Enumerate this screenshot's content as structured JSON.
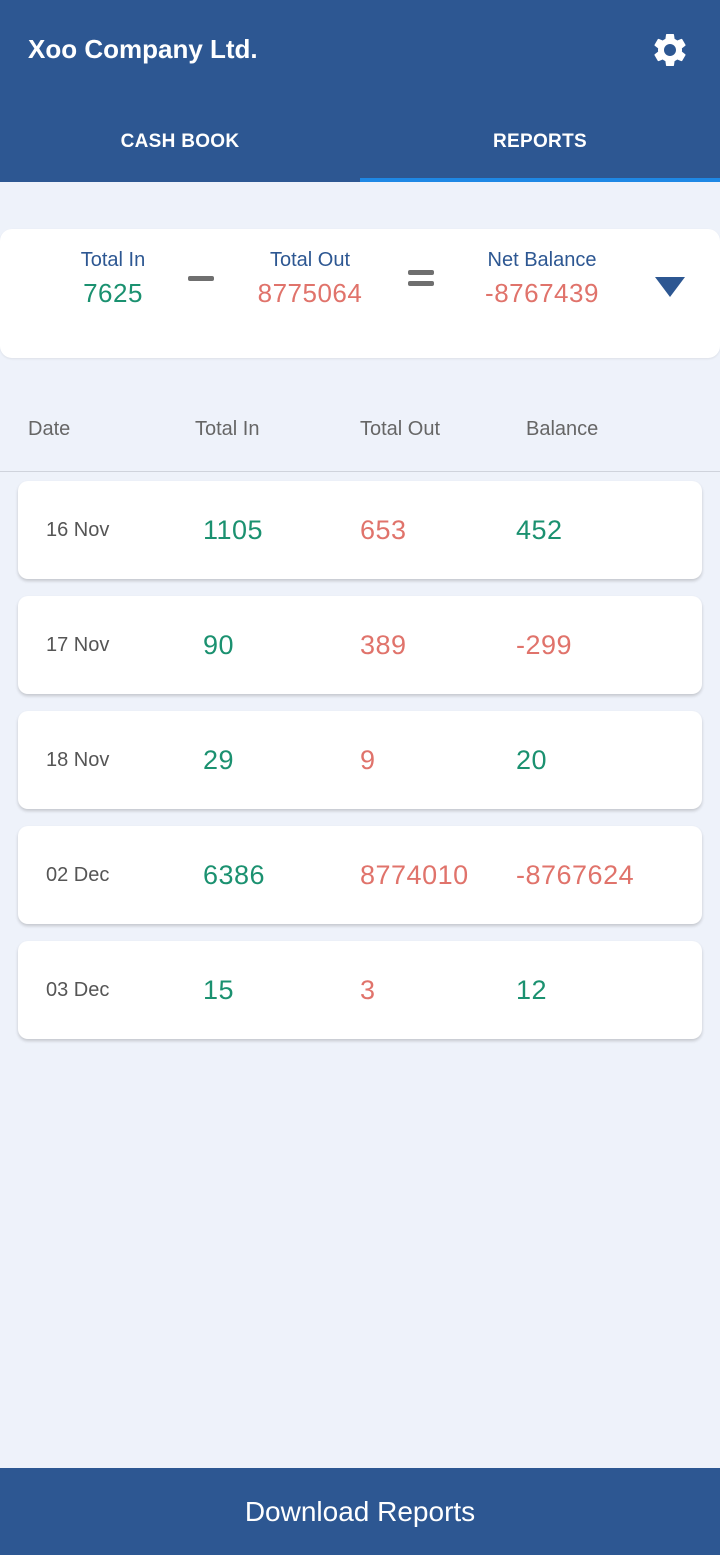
{
  "app": {
    "title": "Xoo Company Ltd."
  },
  "tabs": [
    {
      "label": "CASH BOOK",
      "active": false
    },
    {
      "label": "REPORTS",
      "active": true
    }
  ],
  "summary": {
    "total_in_label": "Total In",
    "total_in_value": "7625",
    "total_out_label": "Total Out",
    "total_out_value": "8775064",
    "net_label": "Net Balance",
    "net_value": "-8767439"
  },
  "table": {
    "headers": [
      "Date",
      "Total In",
      "Total Out",
      "Balance"
    ],
    "rows": [
      {
        "date": "16 Nov",
        "in": "1105",
        "out": "653",
        "balance": "452"
      },
      {
        "date": "17 Nov",
        "in": "90",
        "out": "389",
        "balance": "-299"
      },
      {
        "date": "18 Nov",
        "in": "29",
        "out": "9",
        "balance": "20"
      },
      {
        "date": "02 Dec",
        "in": "6386",
        "out": "8774010",
        "balance": "-8767624"
      },
      {
        "date": "03 Dec",
        "in": "15",
        "out": "3",
        "balance": "12"
      }
    ]
  },
  "footer": {
    "download_label": "Download Reports"
  },
  "colors": {
    "primary": "#2d5792",
    "tab_indicator": "#1e88e5",
    "positive": "#1b9170",
    "negative": "#e0736b",
    "background": "#eef2fa"
  },
  "icons": {
    "settings": "gear-icon",
    "dropdown": "caret-down-icon",
    "minus": "minus-icon",
    "equals": "equals-icon"
  }
}
